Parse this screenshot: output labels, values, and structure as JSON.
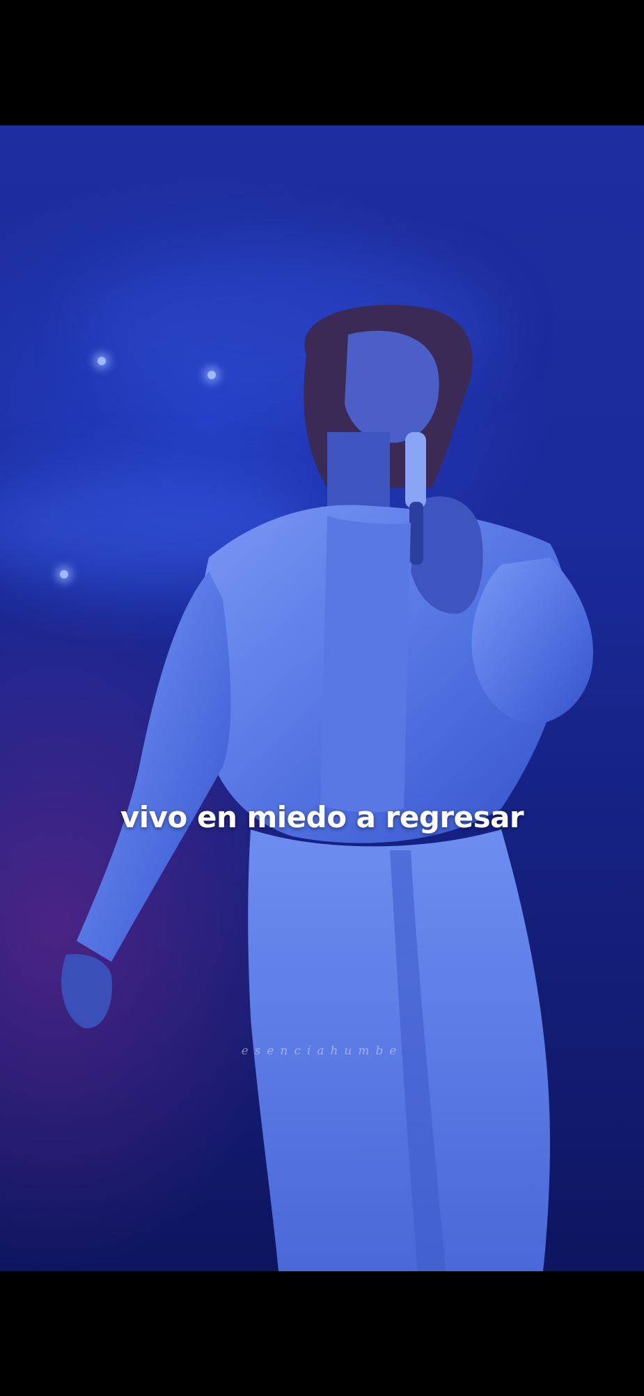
{
  "video": {
    "lyric_caption": "vivo en miedo a regresar",
    "watermark": "esenciahumbe"
  },
  "colors": {
    "background": "#000000",
    "stage_blue": "#1d2fa0",
    "stage_purple": "#5a2a7a",
    "outfit_light_blue": "#6f8ff0",
    "caption_text": "#ffffff"
  }
}
